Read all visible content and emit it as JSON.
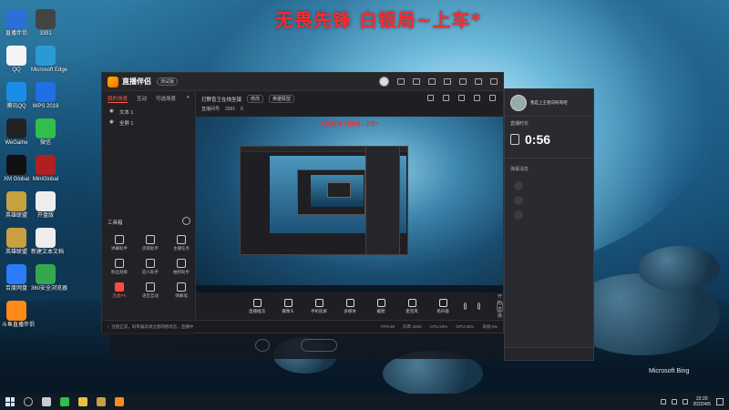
{
  "overlay": {
    "title": "无畏先锋 白银局~上车*"
  },
  "desktop": {
    "icons": [
      {
        "label": "直播伴侣",
        "color": "#2d6fd8"
      },
      {
        "label": "3391",
        "color": "#444"
      },
      {
        "label": "QQ",
        "color": "#f4f4f4"
      },
      {
        "label": "Microsoft Edge",
        "color": "#2a9ad6"
      },
      {
        "label": "腾讯QQ",
        "color": "#1a8ee6"
      },
      {
        "label": "WPS 2019",
        "color": "#1f6fe5"
      },
      {
        "label": "WeGame",
        "color": "#222"
      },
      {
        "label": "微信",
        "color": "#2fbf4a"
      },
      {
        "label": "XM Global",
        "color": "#111"
      },
      {
        "label": "MiniGlobal",
        "color": "#b02020"
      },
      {
        "label": "英雄联盟",
        "color": "#c7a040"
      },
      {
        "label": "开盘版",
        "color": "#eeeeee"
      },
      {
        "label": "英雄联盟",
        "color": "#c7a040"
      },
      {
        "label": "新建文本文档",
        "color": "#eeeeee"
      },
      {
        "label": "百度网盘",
        "color": "#2b7cf6"
      },
      {
        "label": "360安全浏览器",
        "color": "#35a84d"
      },
      {
        "label": "斗鱼直播伴侣",
        "color": "#ff8a1a"
      }
    ]
  },
  "app": {
    "name": "直播伴侣",
    "version": "测试版",
    "tabs": [
      "我的场景",
      "互动",
      "可选场景"
    ],
    "add_label": "+",
    "scenes": [
      "文本 1",
      "全屏 1"
    ],
    "stream": {
      "title": "打野盲王在线坐镇",
      "edit_label": "修改",
      "category_label": "英雄联盟",
      "room_label": "直播间号",
      "room_id": "3391",
      "fans": "6"
    },
    "tools_title": "工具箱",
    "tools": [
      {
        "label": "弹幕助手",
        "active": false
      },
      {
        "label": "房管助手",
        "active": false
      },
      {
        "label": "主播任务",
        "active": false
      },
      {
        "label": "粉丝勋章",
        "active": false
      },
      {
        "label": "迎人助手",
        "active": false
      },
      {
        "label": "抽奖助手",
        "active": false
      },
      {
        "label": "连麦PK",
        "active": true
      },
      {
        "label": "语音互动",
        "active": false
      },
      {
        "label": "弹幕墙",
        "active": false
      }
    ],
    "controls": [
      {
        "label": "直播推流"
      },
      {
        "label": "摄像头"
      },
      {
        "label": "手机投屏"
      },
      {
        "label": "多媒体"
      },
      {
        "label": "截图"
      },
      {
        "label": "麦克风"
      },
      {
        "label": "扬声器"
      }
    ],
    "start_label": "开始直播",
    "status_warn": "!",
    "status_text": "连接正常，码率偏高请注意网络状态，直播中",
    "stats": [
      "FPS:60",
      "码率:4000",
      "CPU:20%",
      "GPU:32%",
      "丢帧:0%"
    ]
  },
  "chat": {
    "streamer": "我是上王者向阿哥吧",
    "subtitle": "直播时长",
    "timer": "0:56",
    "label": "弹幕消息"
  },
  "wallpaper": {
    "brand": "Microsoft Bing"
  },
  "taskbar": {
    "time": "22:20",
    "date": "2022/4/5"
  }
}
